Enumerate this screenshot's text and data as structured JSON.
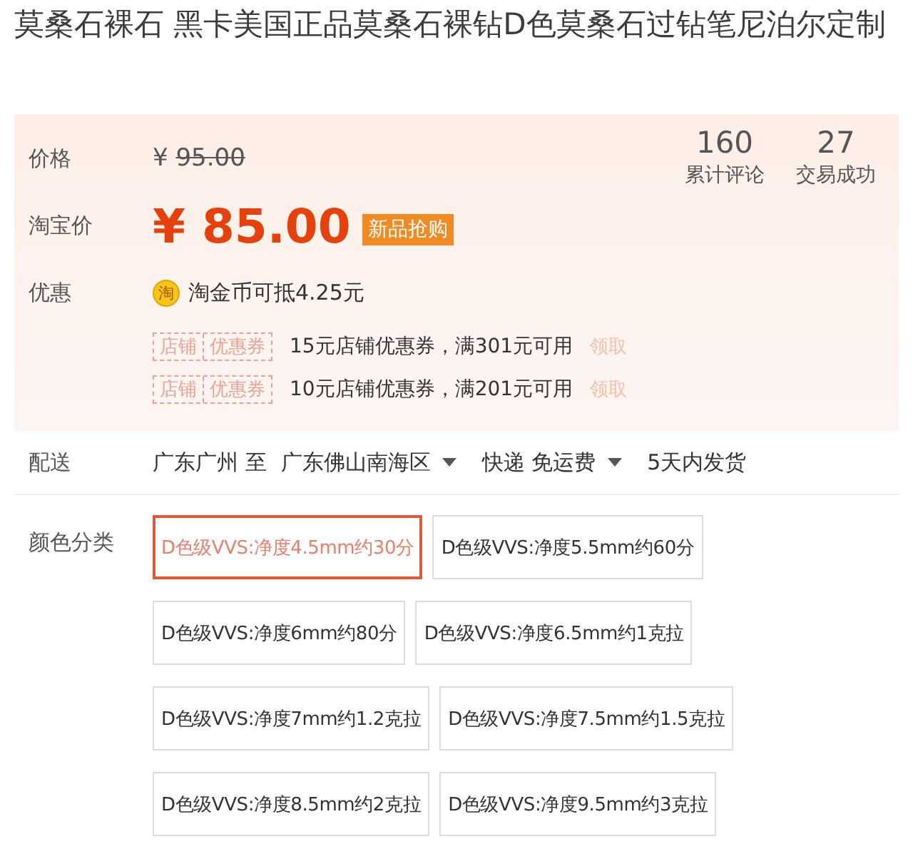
{
  "title": "莫桑石裸石 黑卡美国正品莫桑石裸钻D色莫桑石过钻笔尼泊尔定制",
  "price": {
    "label": "价格",
    "currency": "¥",
    "original": "95.00"
  },
  "stats": [
    {
      "value": "160",
      "label": "累计评论"
    },
    {
      "value": "27",
      "label": "交易成功"
    }
  ],
  "promo_price": {
    "label": "淘宝价",
    "currency": "¥",
    "amount": "85.00",
    "badge": "新品抢购"
  },
  "discount": {
    "label": "优惠",
    "coin_glyph": "淘",
    "text": "淘金币可抵4.25元"
  },
  "coupons": [
    {
      "tag_left": "店铺",
      "tag_right": "优惠券",
      "text": "15元店铺优惠券，满301元可用",
      "action": "领取"
    },
    {
      "tag_left": "店铺",
      "tag_right": "优惠券",
      "text": "10元店铺优惠券，满201元可用",
      "action": "领取"
    }
  ],
  "delivery": {
    "label": "配送",
    "from": "广东广州 至",
    "to": "广东佛山南海区",
    "shipping": "快递 免运费",
    "lead_time": "5天内发货"
  },
  "colors": {
    "label": "颜色分类",
    "options": [
      {
        "label": "D色级VVS:净度4.5mm约30分",
        "selected": true
      },
      {
        "label": "D色级VVS:净度5.5mm约60分",
        "selected": false
      },
      {
        "label": "D色级VVS:净度6mm约80分",
        "selected": false
      },
      {
        "label": "D色级VVS:净度6.5mm约1克拉",
        "selected": false
      },
      {
        "label": "D色级VVS:净度7mm约1.2克拉",
        "selected": false
      },
      {
        "label": "D色级VVS:净度7.5mm约1.5克拉",
        "selected": false
      },
      {
        "label": "D色级VVS:净度8.5mm约2克拉",
        "selected": false
      },
      {
        "label": "D色级VVS:净度9.5mm约3克拉",
        "selected": false
      }
    ]
  }
}
